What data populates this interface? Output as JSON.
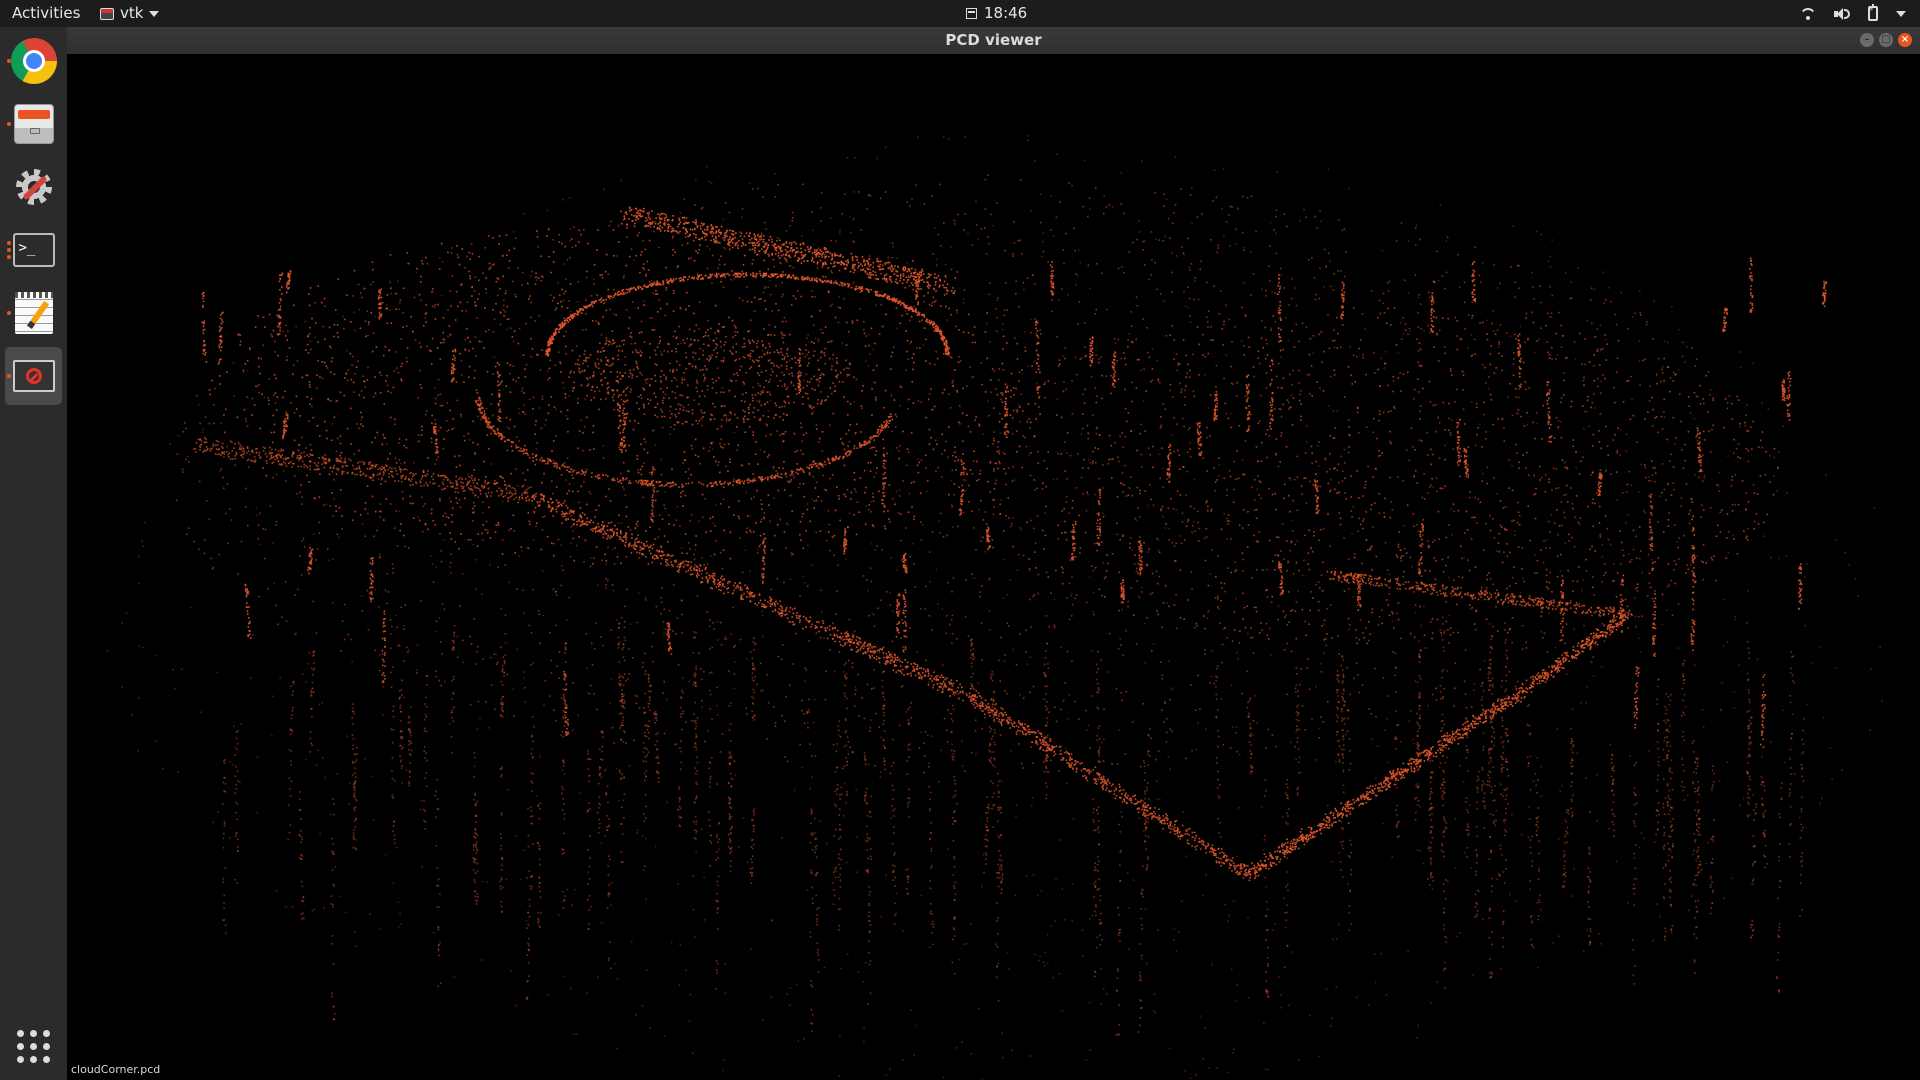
{
  "topbar": {
    "activities": "Activities",
    "app_name": "vtk",
    "clock": "18:46",
    "icons": [
      "wifi-icon",
      "volume-icon",
      "battery-icon",
      "chevron-down-icon"
    ]
  },
  "dock": {
    "items": [
      {
        "name": "chrome",
        "icon": "chrome-icon",
        "running": true,
        "dots": 1
      },
      {
        "name": "files",
        "icon": "files-icon",
        "running": true,
        "dots": 1
      },
      {
        "name": "settings",
        "icon": "settings-icon",
        "running": false,
        "dots": 0
      },
      {
        "name": "terminal",
        "icon": "terminal-icon",
        "running": true,
        "dots": 3
      },
      {
        "name": "text-editor",
        "icon": "text-editor-icon",
        "running": true,
        "dots": 1
      },
      {
        "name": "pcd-viewer",
        "icon": "blocked-icon",
        "running": true,
        "active": true,
        "dots": 1
      }
    ],
    "terminal_prompt": ">_",
    "show_apps_icon": "apps-grid-icon"
  },
  "window": {
    "title": "PCD viewer",
    "controls": {
      "minimize": "–",
      "maximize": "□",
      "close": "×"
    }
  },
  "viewer": {
    "point_color": "#e0552b",
    "background": "#000000",
    "status_text": "cloudCorner.pcd"
  }
}
